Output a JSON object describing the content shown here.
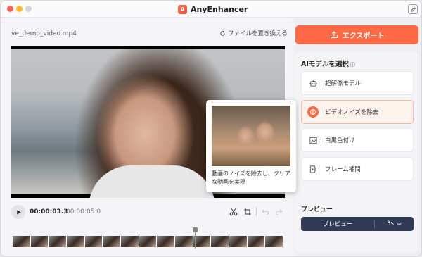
{
  "app": {
    "title": "AnyEnhancer",
    "logo_glyph": "A"
  },
  "colors": {
    "accent": "#ff6a45",
    "preview_bar": "#2f3a55",
    "active_bg": "#fff3ee"
  },
  "left": {
    "filename": "ve_demo_video.mp4",
    "replace_label": "ファイルを置き換える",
    "time_current": "00:00:03.3",
    "time_total": "/00:00:05.0"
  },
  "right": {
    "export_label": "エクスポート",
    "model_heading": "AIモデルを選択",
    "models": [
      {
        "label": "超解像モデル",
        "icon": "robot-icon"
      },
      {
        "label": "ビデオノイズを除去",
        "icon": "denoise-icon"
      },
      {
        "label": "白黒色付け",
        "icon": "colorize-icon"
      },
      {
        "label": "フレーム補間",
        "icon": "frame-interp-icon"
      }
    ],
    "preview_heading": "プレビュー",
    "preview_button": "プレビュー",
    "preview_duration": "3s"
  },
  "tooltip": {
    "text": "動画のノイズを除去し、クリアな動画を実現"
  }
}
